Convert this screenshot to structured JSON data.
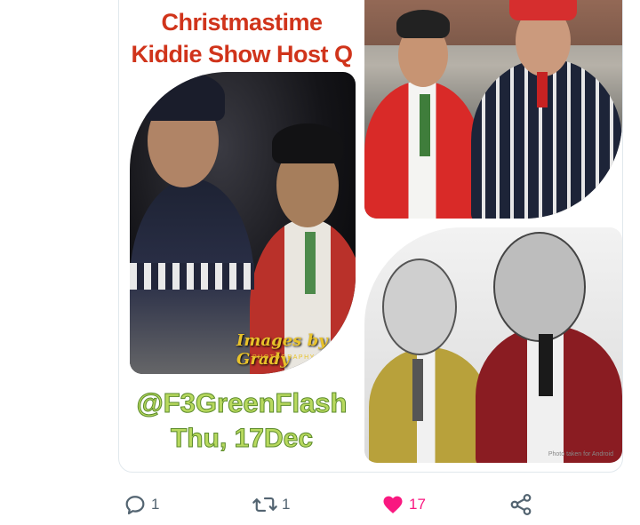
{
  "media": {
    "title_line1": "Christmastime",
    "title_line2": "Kiddie Show Host Q",
    "watermark": "Images by Grady",
    "watermark_sub": "PHOTOGRAPHY STUDIO",
    "handle": "@F3GreenFlash",
    "date": "Thu, 17Dec",
    "photo_credit": "Photo taken for Android"
  },
  "actions": {
    "reply_count": "1",
    "retweet_count": "1",
    "like_count": "17"
  },
  "colors": {
    "title": "#d0341b",
    "handle": "#b8d95e",
    "like": "#f91880",
    "icon": "#536471"
  },
  "icons": {
    "reply": "reply-icon",
    "retweet": "retweet-icon",
    "like": "heart-icon",
    "share": "share-icon"
  }
}
